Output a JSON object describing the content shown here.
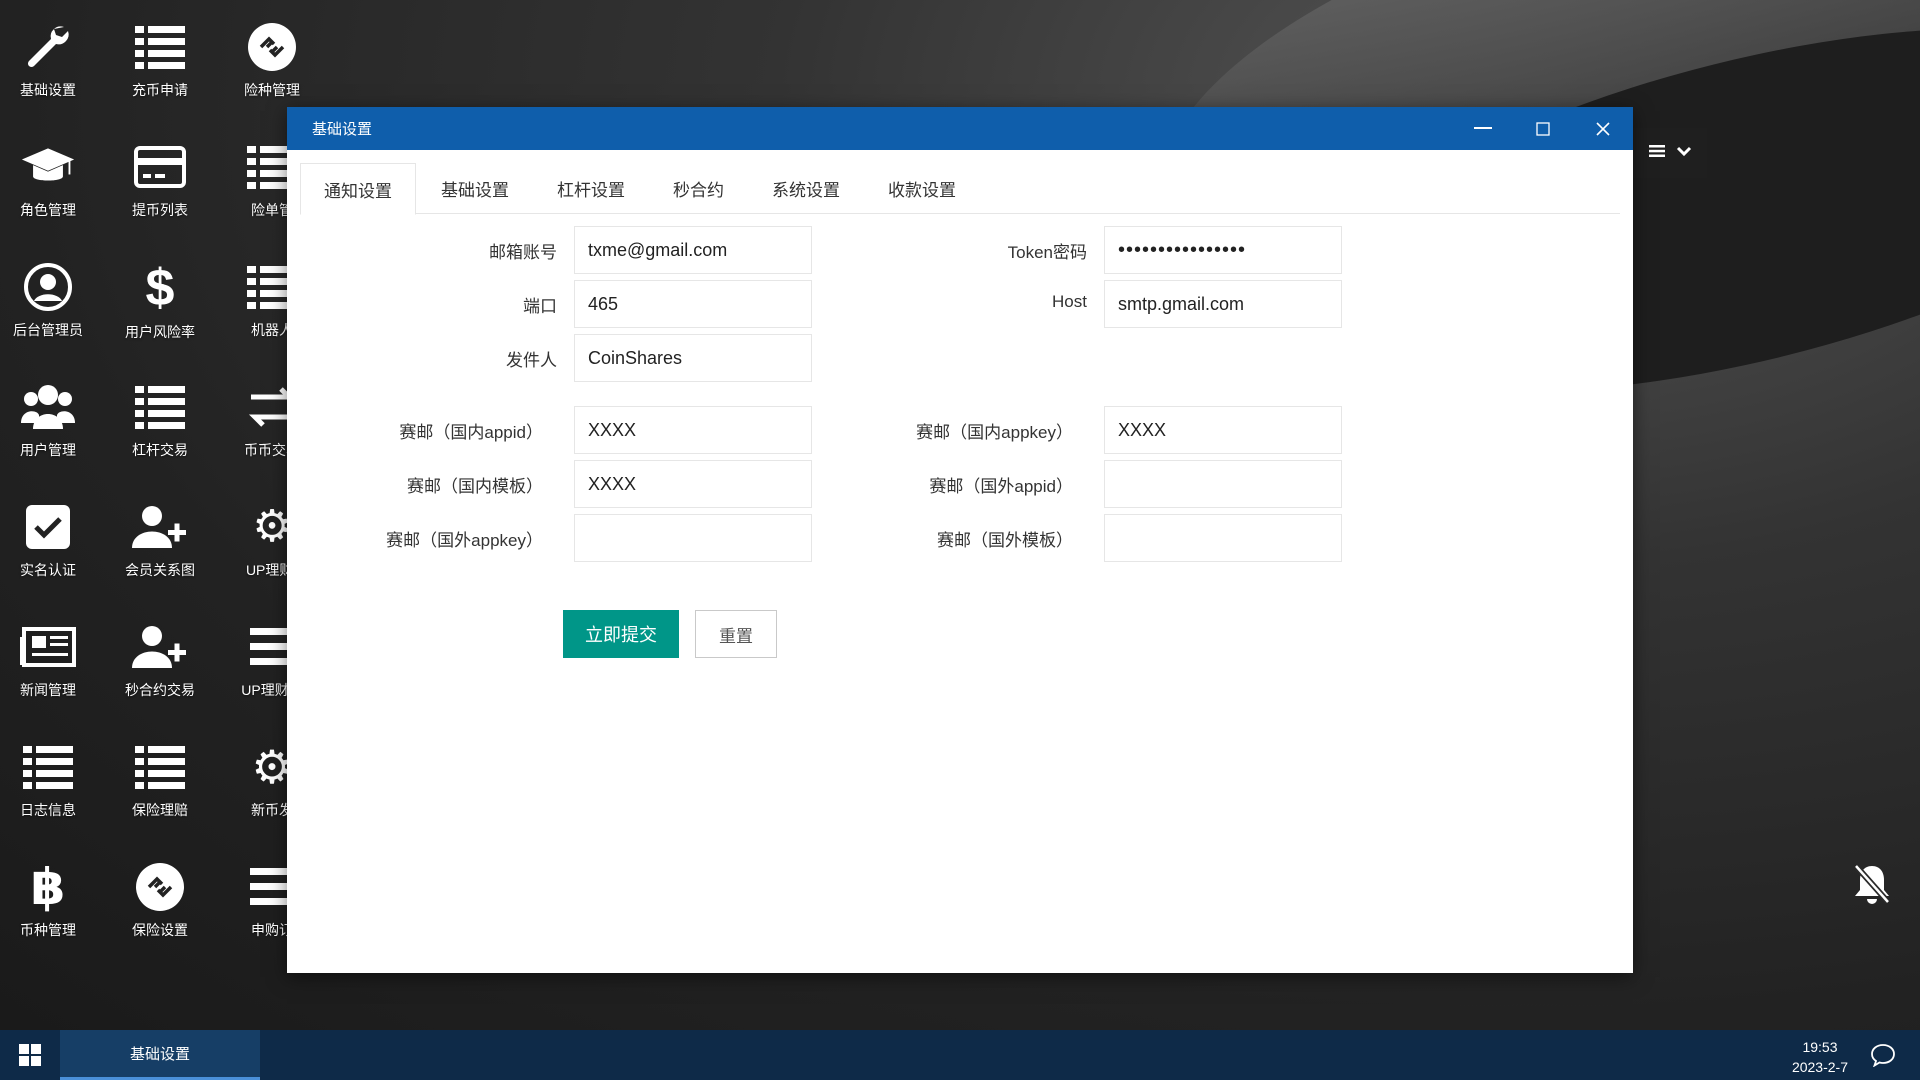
{
  "desktop": {
    "icons": [
      {
        "label": "基础设置",
        "icon": "wrench-icon"
      },
      {
        "label": "充币申请",
        "icon": "list-icon"
      },
      {
        "label": "险种管理",
        "icon": "exchange-icon"
      },
      {
        "label": "角色管理",
        "icon": "graduation-cap-icon"
      },
      {
        "label": "提币列表",
        "icon": "credit-card-icon"
      },
      {
        "label": "险单管",
        "icon": "list-icon"
      },
      {
        "label": "后台管理员",
        "icon": "user-circle-icon"
      },
      {
        "label": "用户风险率",
        "icon": "dollar-icon"
      },
      {
        "label": "机器人",
        "icon": "list-icon"
      },
      {
        "label": "用户管理",
        "icon": "users-icon"
      },
      {
        "label": "杠杆交易",
        "icon": "list-icon"
      },
      {
        "label": "币币交易",
        "icon": "arrows-icon"
      },
      {
        "label": "实名认证",
        "icon": "check-square-icon"
      },
      {
        "label": "会员关系图",
        "icon": "user-plus-icon"
      },
      {
        "label": "UP理财(",
        "icon": "gears-icon"
      },
      {
        "label": "新闻管理",
        "icon": "newspaper-icon"
      },
      {
        "label": "秒合约交易",
        "icon": "user-plus-icon"
      },
      {
        "label": "UP理财订",
        "icon": "bars-icon"
      },
      {
        "label": "日志信息",
        "icon": "list-icon"
      },
      {
        "label": "保险理赔",
        "icon": "list-icon"
      },
      {
        "label": "新币发",
        "icon": "gear-icon"
      },
      {
        "label": "币种管理",
        "icon": "bitcoin-icon"
      },
      {
        "label": "保险设置",
        "icon": "exchange-icon"
      },
      {
        "label": "申购订",
        "icon": "bars-icon"
      }
    ]
  },
  "window": {
    "title": "基础设置",
    "tabs": [
      {
        "label": "通知设置"
      },
      {
        "label": "基础设置"
      },
      {
        "label": "杠杆设置"
      },
      {
        "label": "秒合约"
      },
      {
        "label": "系统设置"
      },
      {
        "label": "收款设置"
      }
    ],
    "active_tab": 0,
    "form": {
      "email_label": "邮箱账号",
      "email_value": "txme@gmail.com",
      "token_label": "Token密码",
      "token_value": "••••••••••••••••",
      "port_label": "端口",
      "port_value": "465",
      "host_label": "Host",
      "host_value": "smtp.gmail.com",
      "sender_label": "发件人",
      "sender_value": "CoinShares",
      "cn_appid_label": "赛邮（国内appid）",
      "cn_appid_value": "XXXX",
      "cn_appkey_label": "赛邮（国内appkey）",
      "cn_appkey_value": "XXXX",
      "cn_template_label": "赛邮（国内模板）",
      "cn_template_value": "XXXX",
      "intl_appid_label": "赛邮（国外appid）",
      "intl_appid_value": "",
      "intl_appkey_label": "赛邮（国外appkey）",
      "intl_appkey_value": "",
      "intl_template_label": "赛邮（国外模板）",
      "intl_template_value": "",
      "submit_label": "立即提交",
      "reset_label": "重置"
    }
  },
  "taskbar": {
    "task_label": "基础设置",
    "time": "19:53",
    "date": "2023-2-7"
  },
  "colors": {
    "titlebar": "#0f5eab",
    "submit": "#009688",
    "taskbar": "#0e2a48"
  }
}
